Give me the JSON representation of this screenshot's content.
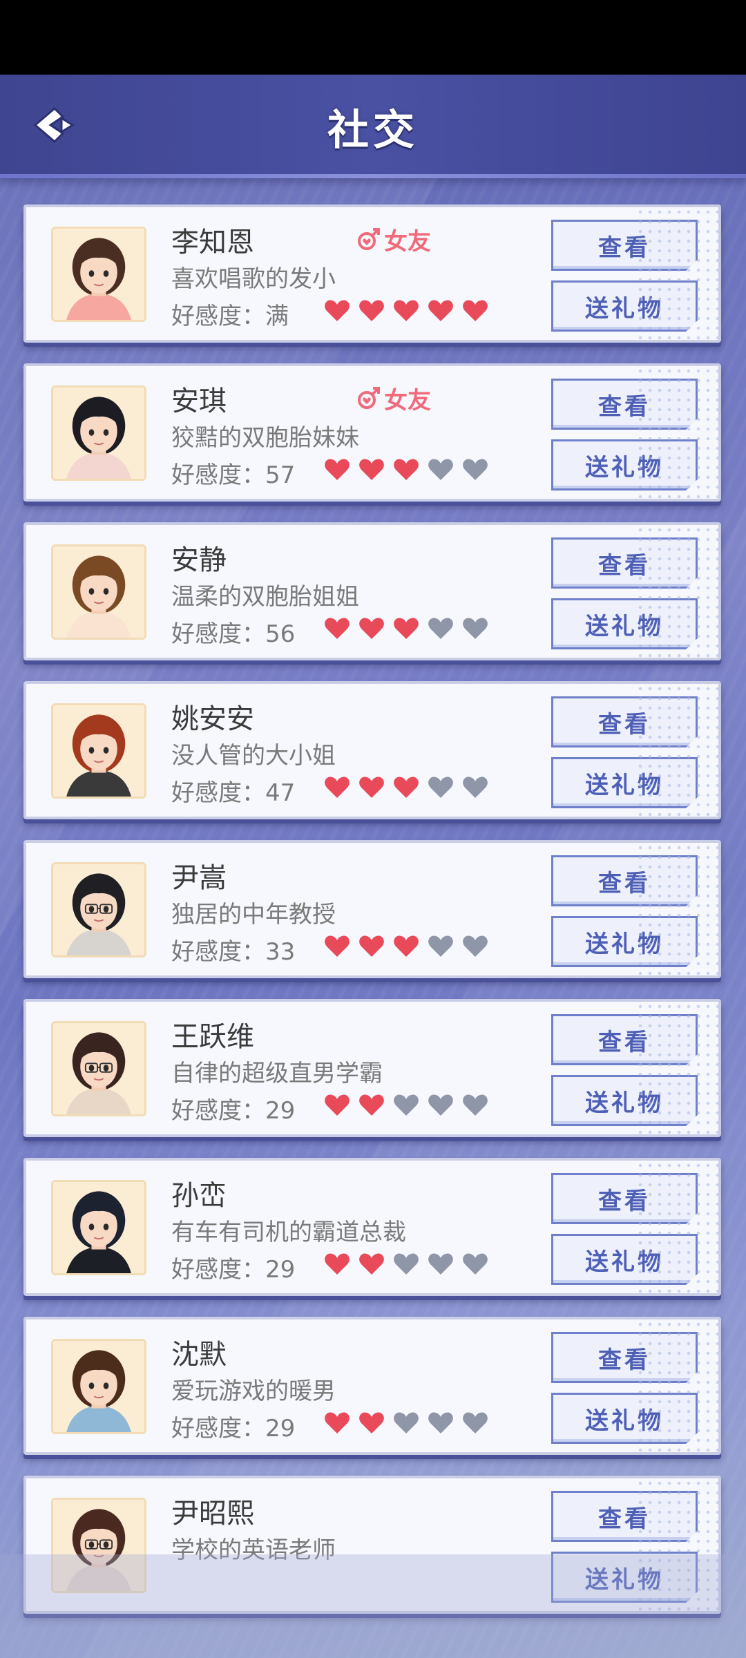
{
  "header": {
    "title": "社交",
    "back_icon": "back-arrow-icon"
  },
  "labels": {
    "favor": "好感度：",
    "view": "查看",
    "gift": "送礼物",
    "girlfriend": "女友"
  },
  "colors": {
    "heart_on": "#e84a5a",
    "heart_off": "#8f96a8",
    "badge": "#f06a7a",
    "button_text": "#4e5fb6"
  },
  "characters": [
    {
      "name": "李知恩",
      "desc": "喜欢唱歌的发小",
      "favor": "满",
      "hearts": 5,
      "girlfriend": true,
      "avatar": "girl-long-brown-hair"
    },
    {
      "name": "安琪",
      "desc": "狡黠的双胞胎妹妹",
      "favor": "57",
      "hearts": 3,
      "girlfriend": true,
      "avatar": "girl-black-twintails"
    },
    {
      "name": "安静",
      "desc": "温柔的双胞胎姐姐",
      "favor": "56",
      "hearts": 3,
      "girlfriend": false,
      "avatar": "girl-bob-brown-hair"
    },
    {
      "name": "姚安安",
      "desc": "没人管的大小姐",
      "favor": "47",
      "hearts": 3,
      "girlfriend": false,
      "avatar": "girl-red-hair"
    },
    {
      "name": "尹嵩",
      "desc": "独居的中年教授",
      "favor": "33",
      "hearts": 3,
      "girlfriend": false,
      "avatar": "man-glasses-grey"
    },
    {
      "name": "王跃维",
      "desc": "自律的超级直男学霸",
      "favor": "29",
      "hearts": 2,
      "girlfriend": false,
      "avatar": "boy-glasses-brown"
    },
    {
      "name": "孙峦",
      "desc": "有车有司机的霸道总裁",
      "favor": "29",
      "hearts": 2,
      "girlfriend": false,
      "avatar": "man-suit-dark"
    },
    {
      "name": "沈默",
      "desc": "爱玩游戏的暖男",
      "favor": "29",
      "hearts": 2,
      "girlfriend": false,
      "avatar": "boy-hoodie-brown"
    },
    {
      "name": "尹昭熙",
      "desc": "学校的英语老师",
      "favor": "",
      "hearts": 0,
      "girlfriend": false,
      "avatar": "woman-glasses-ponytail"
    }
  ]
}
